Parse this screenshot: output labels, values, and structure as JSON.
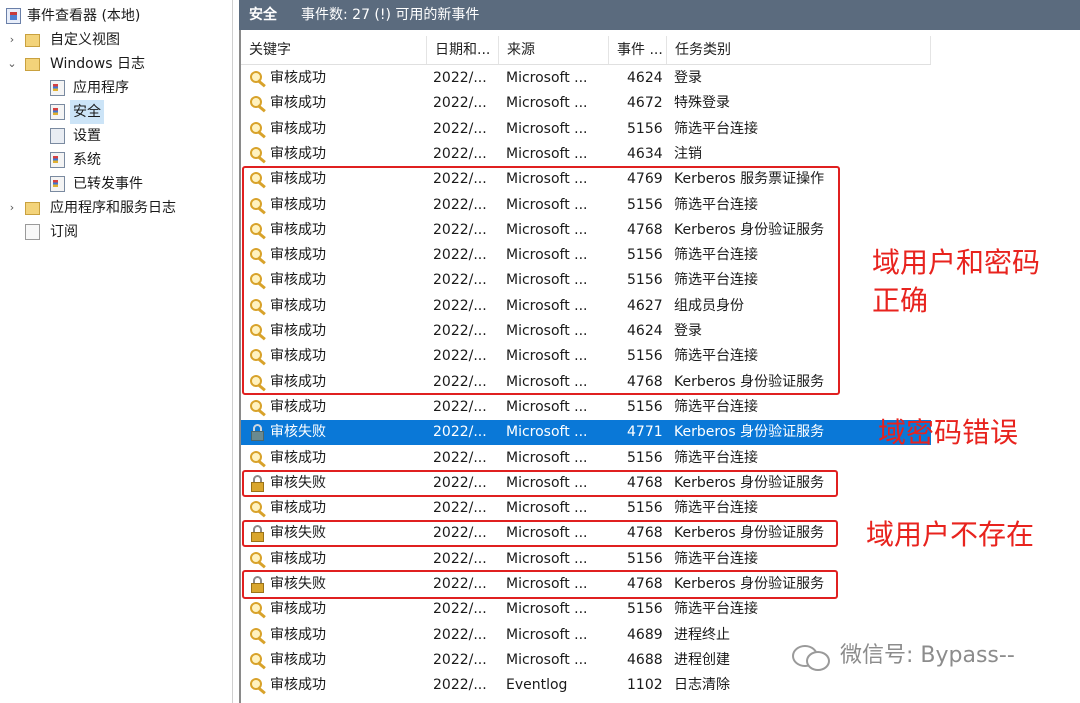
{
  "tree": {
    "items": [
      {
        "label": "事件查看器 (本地)",
        "icon": "event-viewer-icon",
        "arrow": ""
      },
      {
        "label": "自定义视图",
        "icon": "folder-icon",
        "arrow": "›"
      },
      {
        "label": "Windows 日志",
        "icon": "folder-icon",
        "arrow": "⌄"
      },
      {
        "label": "应用程序",
        "icon": "log-icon",
        "arrow": ""
      },
      {
        "label": "安全",
        "icon": "log-icon",
        "arrow": "",
        "selected": true
      },
      {
        "label": "设置",
        "icon": "log-icon",
        "arrow": ""
      },
      {
        "label": "系统",
        "icon": "log-icon",
        "arrow": ""
      },
      {
        "label": "已转发事件",
        "icon": "log-icon",
        "arrow": ""
      },
      {
        "label": "应用程序和服务日志",
        "icon": "folder-icon",
        "arrow": "›"
      },
      {
        "label": "订阅",
        "icon": "subscription-icon",
        "arrow": ""
      }
    ]
  },
  "header": {
    "title": "安全",
    "count": "事件数: 27 (!) 可用的新事件"
  },
  "columns": {
    "keyword": "关键字",
    "date": "日期和...",
    "source": "来源",
    "event_id": "事件 ...",
    "task": "任务类别"
  },
  "rows": [
    {
      "keyword": "审核成功",
      "date": "2022/...",
      "source": "Microsoft ...",
      "event_id": "4624",
      "task": "登录",
      "icon": "key-icon"
    },
    {
      "keyword": "审核成功",
      "date": "2022/...",
      "source": "Microsoft ...",
      "event_id": "4672",
      "task": "特殊登录",
      "icon": "key-icon"
    },
    {
      "keyword": "审核成功",
      "date": "2022/...",
      "source": "Microsoft ...",
      "event_id": "5156",
      "task": "筛选平台连接",
      "icon": "key-icon"
    },
    {
      "keyword": "审核成功",
      "date": "2022/...",
      "source": "Microsoft ...",
      "event_id": "4634",
      "task": "注销",
      "icon": "key-icon"
    },
    {
      "keyword": "审核成功",
      "date": "2022/...",
      "source": "Microsoft ...",
      "event_id": "4769",
      "task": "Kerberos 服务票证操作",
      "icon": "key-icon"
    },
    {
      "keyword": "审核成功",
      "date": "2022/...",
      "source": "Microsoft ...",
      "event_id": "5156",
      "task": "筛选平台连接",
      "icon": "key-icon"
    },
    {
      "keyword": "审核成功",
      "date": "2022/...",
      "source": "Microsoft ...",
      "event_id": "4768",
      "task": "Kerberos 身份验证服务",
      "icon": "key-icon"
    },
    {
      "keyword": "审核成功",
      "date": "2022/...",
      "source": "Microsoft ...",
      "event_id": "5156",
      "task": "筛选平台连接",
      "icon": "key-icon"
    },
    {
      "keyword": "审核成功",
      "date": "2022/...",
      "source": "Microsoft ...",
      "event_id": "5156",
      "task": "筛选平台连接",
      "icon": "key-icon"
    },
    {
      "keyword": "审核成功",
      "date": "2022/...",
      "source": "Microsoft ...",
      "event_id": "4627",
      "task": "组成员身份",
      "icon": "key-icon"
    },
    {
      "keyword": "审核成功",
      "date": "2022/...",
      "source": "Microsoft ...",
      "event_id": "4624",
      "task": "登录",
      "icon": "key-icon"
    },
    {
      "keyword": "审核成功",
      "date": "2022/...",
      "source": "Microsoft ...",
      "event_id": "5156",
      "task": "筛选平台连接",
      "icon": "key-icon"
    },
    {
      "keyword": "审核成功",
      "date": "2022/...",
      "source": "Microsoft ...",
      "event_id": "4768",
      "task": "Kerberos 身份验证服务",
      "icon": "key-icon"
    },
    {
      "keyword": "审核成功",
      "date": "2022/...",
      "source": "Microsoft ...",
      "event_id": "5156",
      "task": "筛选平台连接",
      "icon": "key-icon"
    },
    {
      "keyword": "审核失败",
      "date": "2022/...",
      "source": "Microsoft ...",
      "event_id": "4771",
      "task": "Kerberos 身份验证服务",
      "icon": "lock-icon",
      "selected": true
    },
    {
      "keyword": "审核成功",
      "date": "2022/...",
      "source": "Microsoft ...",
      "event_id": "5156",
      "task": "筛选平台连接",
      "icon": "key-icon"
    },
    {
      "keyword": "审核失败",
      "date": "2022/...",
      "source": "Microsoft ...",
      "event_id": "4768",
      "task": "Kerberos 身份验证服务",
      "icon": "lock-icon"
    },
    {
      "keyword": "审核成功",
      "date": "2022/...",
      "source": "Microsoft ...",
      "event_id": "5156",
      "task": "筛选平台连接",
      "icon": "key-icon"
    },
    {
      "keyword": "审核失败",
      "date": "2022/...",
      "source": "Microsoft ...",
      "event_id": "4768",
      "task": "Kerberos 身份验证服务",
      "icon": "lock-icon"
    },
    {
      "keyword": "审核成功",
      "date": "2022/...",
      "source": "Microsoft ...",
      "event_id": "5156",
      "task": "筛选平台连接",
      "icon": "key-icon"
    },
    {
      "keyword": "审核失败",
      "date": "2022/...",
      "source": "Microsoft ...",
      "event_id": "4768",
      "task": "Kerberos 身份验证服务",
      "icon": "lock-icon"
    },
    {
      "keyword": "审核成功",
      "date": "2022/...",
      "source": "Microsoft ...",
      "event_id": "5156",
      "task": "筛选平台连接",
      "icon": "key-icon"
    },
    {
      "keyword": "审核成功",
      "date": "2022/...",
      "source": "Microsoft ...",
      "event_id": "4689",
      "task": "进程终止",
      "icon": "key-icon"
    },
    {
      "keyword": "审核成功",
      "date": "2022/...",
      "source": "Microsoft ...",
      "event_id": "4688",
      "task": "进程创建",
      "icon": "key-icon"
    },
    {
      "keyword": "审核成功",
      "date": "2022/...",
      "source": "Eventlog",
      "event_id": "1102",
      "task": "日志清除",
      "icon": "key-icon"
    }
  ],
  "annotations": {
    "correct_line1": "域用户和密码",
    "correct_line2": "正确",
    "wrong_password": "域密码错误",
    "no_user": "域用户不存在"
  },
  "watermark": "微信号: Bypass--",
  "colors": {
    "annotation": "#e8231e",
    "selection": "#0a78d7",
    "header_bar": "#5b6b7e"
  }
}
